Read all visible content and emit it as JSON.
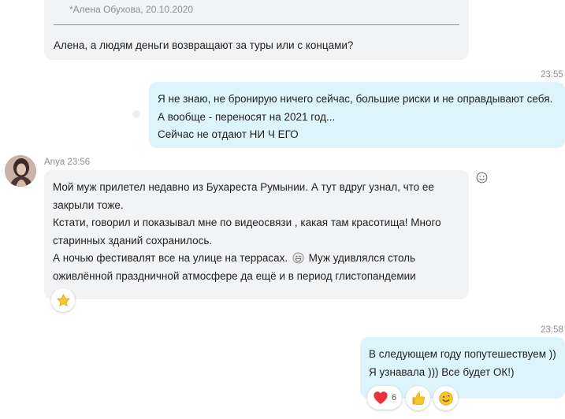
{
  "quoted_message": {
    "author_line": "*Алена Обухова, 20.10.2020",
    "text": "Алена, а людям деньги возвращают за туры или с концами?"
  },
  "outgoing_1": {
    "time": "23:55",
    "lines": [
      "Я не знаю, не бронирую ничего сейчас, большие риски и не оправдывают себя.",
      "А вообще - переносят на 2021 год...",
      "Сейчас не отдают НИ Ч ЕГО"
    ]
  },
  "incoming_anya": {
    "sender": "Anya",
    "time": "23:56",
    "lines": [
      "Мой муж прилетел недавно из Бухареста Румынии. А тут вдруг узнал, что ее",
      "закрыли тоже.",
      "Кстати, говорил и показывал мне по видеосвязи , какая там красотища! Много",
      "старинных зданий сохранилось.",
      "А ночью фестивалят все на улице на террасах.",
      "Муж удивлялся столь",
      "оживлённой праздничной атмосфере да ещё и в период глистопандемии"
    ],
    "reaction_icon": "star-icon"
  },
  "outgoing_2": {
    "time": "23:58",
    "lines": [
      "В следующем году попутешествуем ))",
      "Я узнавала ))) Все будет ОК!)"
    ],
    "reactions": {
      "heart_count": "6",
      "icons": [
        "heart-icon",
        "thumbs-up-icon",
        "smile-icon"
      ]
    }
  },
  "colors": {
    "incoming_bubble": "#f2f3f5",
    "outgoing_bubble": "#def4fc",
    "timestamp": "#8a8f96"
  }
}
